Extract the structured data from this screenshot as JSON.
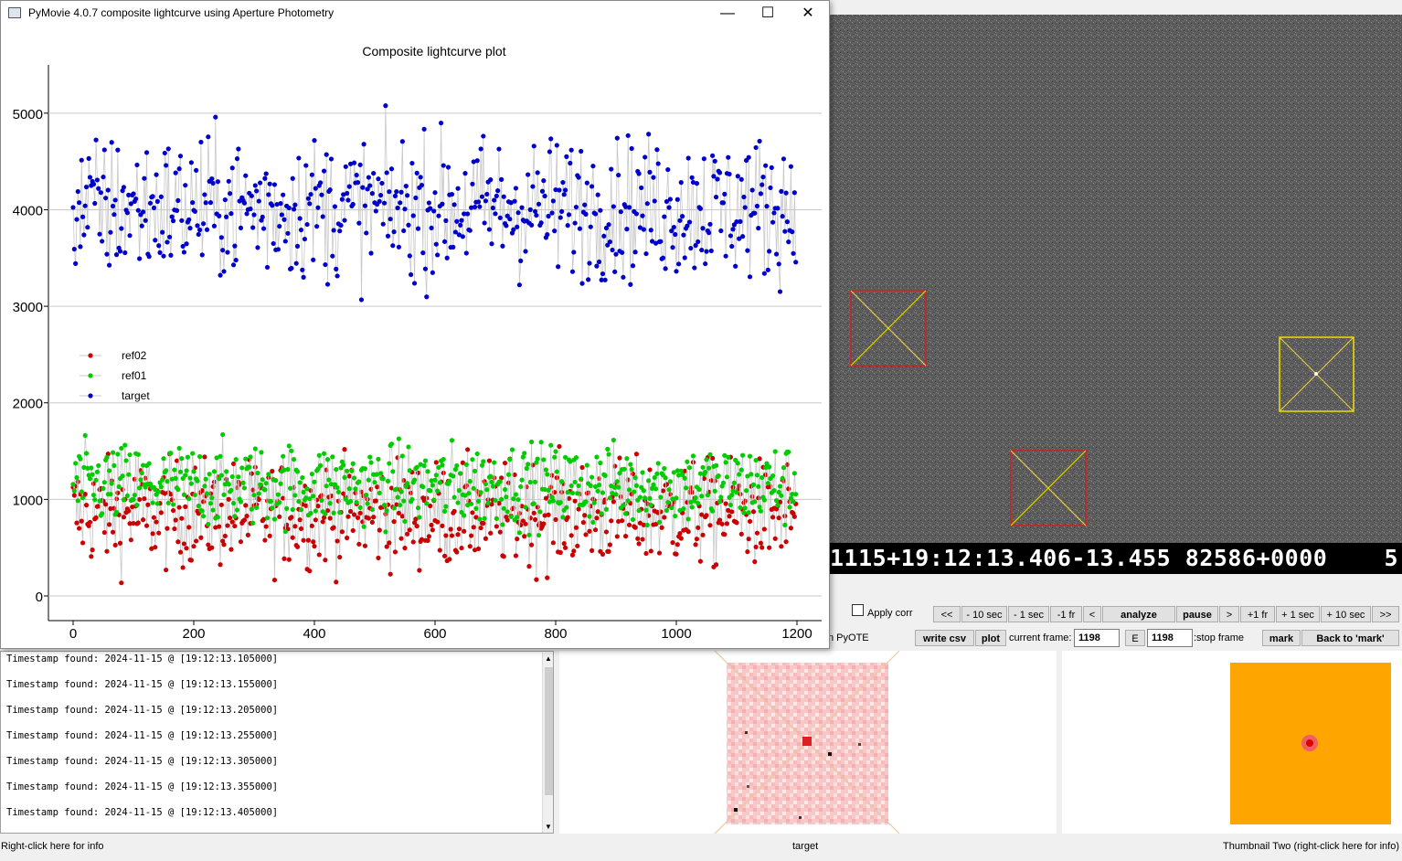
{
  "window": {
    "title": "PyMovie 4.0.7 composite lightcurve using Aperture Photometry",
    "minimize_glyph": "—",
    "maximize_glyph": "☐",
    "close_glyph": "✕"
  },
  "video": {
    "timestamp_overlay": "1115+19:12:13.406-13.455 82586+0000    5"
  },
  "controls": {
    "apply_corr_label": "Apply corr",
    "pyote_partial": "n PyOTE",
    "buttons_row1": [
      "<<",
      "- 10 sec",
      "- 1 sec",
      "-1 fr",
      "<",
      "analyze",
      "pause",
      ">",
      "+1 fr",
      "+ 1 sec",
      "+ 10 sec",
      ">>"
    ],
    "write_csv": "write csv",
    "plot": "plot",
    "current_frame_label": "current frame:",
    "current_frame_value": "1198",
    "e_label": "E",
    "stop_frame_value": "1198",
    "stop_frame_label": ":stop frame",
    "mark": "mark",
    "back_to_mark": "Back to 'mark'"
  },
  "log": {
    "lines": [
      "Timestamp found: 2024-11-15 @ [19:12:13.105000]",
      "Timestamp found: 2024-11-15 @ [19:12:13.155000]",
      "Timestamp found: 2024-11-15 @ [19:12:13.205000]",
      "Timestamp found: 2024-11-15 @ [19:12:13.255000]",
      "Timestamp found: 2024-11-15 @ [19:12:13.305000]",
      "Timestamp found: 2024-11-15 @ [19:12:13.355000]",
      "Timestamp found: 2024-11-15 @ [19:12:13.405000]"
    ]
  },
  "status": {
    "left": "Right-click here for info",
    "middle": "target",
    "right": "Thumbnail Two (right-click here for info)"
  },
  "colors": {
    "target": "#0000cc",
    "ref01": "#00cc00",
    "ref02": "#cc0000",
    "thumb_two_bg": "#ffa500",
    "aperture_red": "#d02020",
    "aperture_yellow": "#f0e000"
  },
  "chart_data": {
    "type": "scatter",
    "title": "Composite lightcurve plot",
    "xlim": [
      0,
      1200
    ],
    "ylim": [
      0,
      5500
    ],
    "x_ticks": [
      0,
      200,
      400,
      600,
      800,
      1000,
      1200
    ],
    "y_ticks": [
      0,
      1000,
      2000,
      3000,
      4000,
      5000
    ],
    "grid": "horizontal",
    "legend_position": "middle-left",
    "n_frames": 1200,
    "series": [
      {
        "name": "ref02",
        "color": "#cc0000",
        "mean": 850,
        "spread": 300
      },
      {
        "name": "ref01",
        "color": "#00cc00",
        "mean": 1150,
        "spread": 230
      },
      {
        "name": "target",
        "color": "#0000cc",
        "mean": 4020,
        "spread": 400
      }
    ]
  }
}
